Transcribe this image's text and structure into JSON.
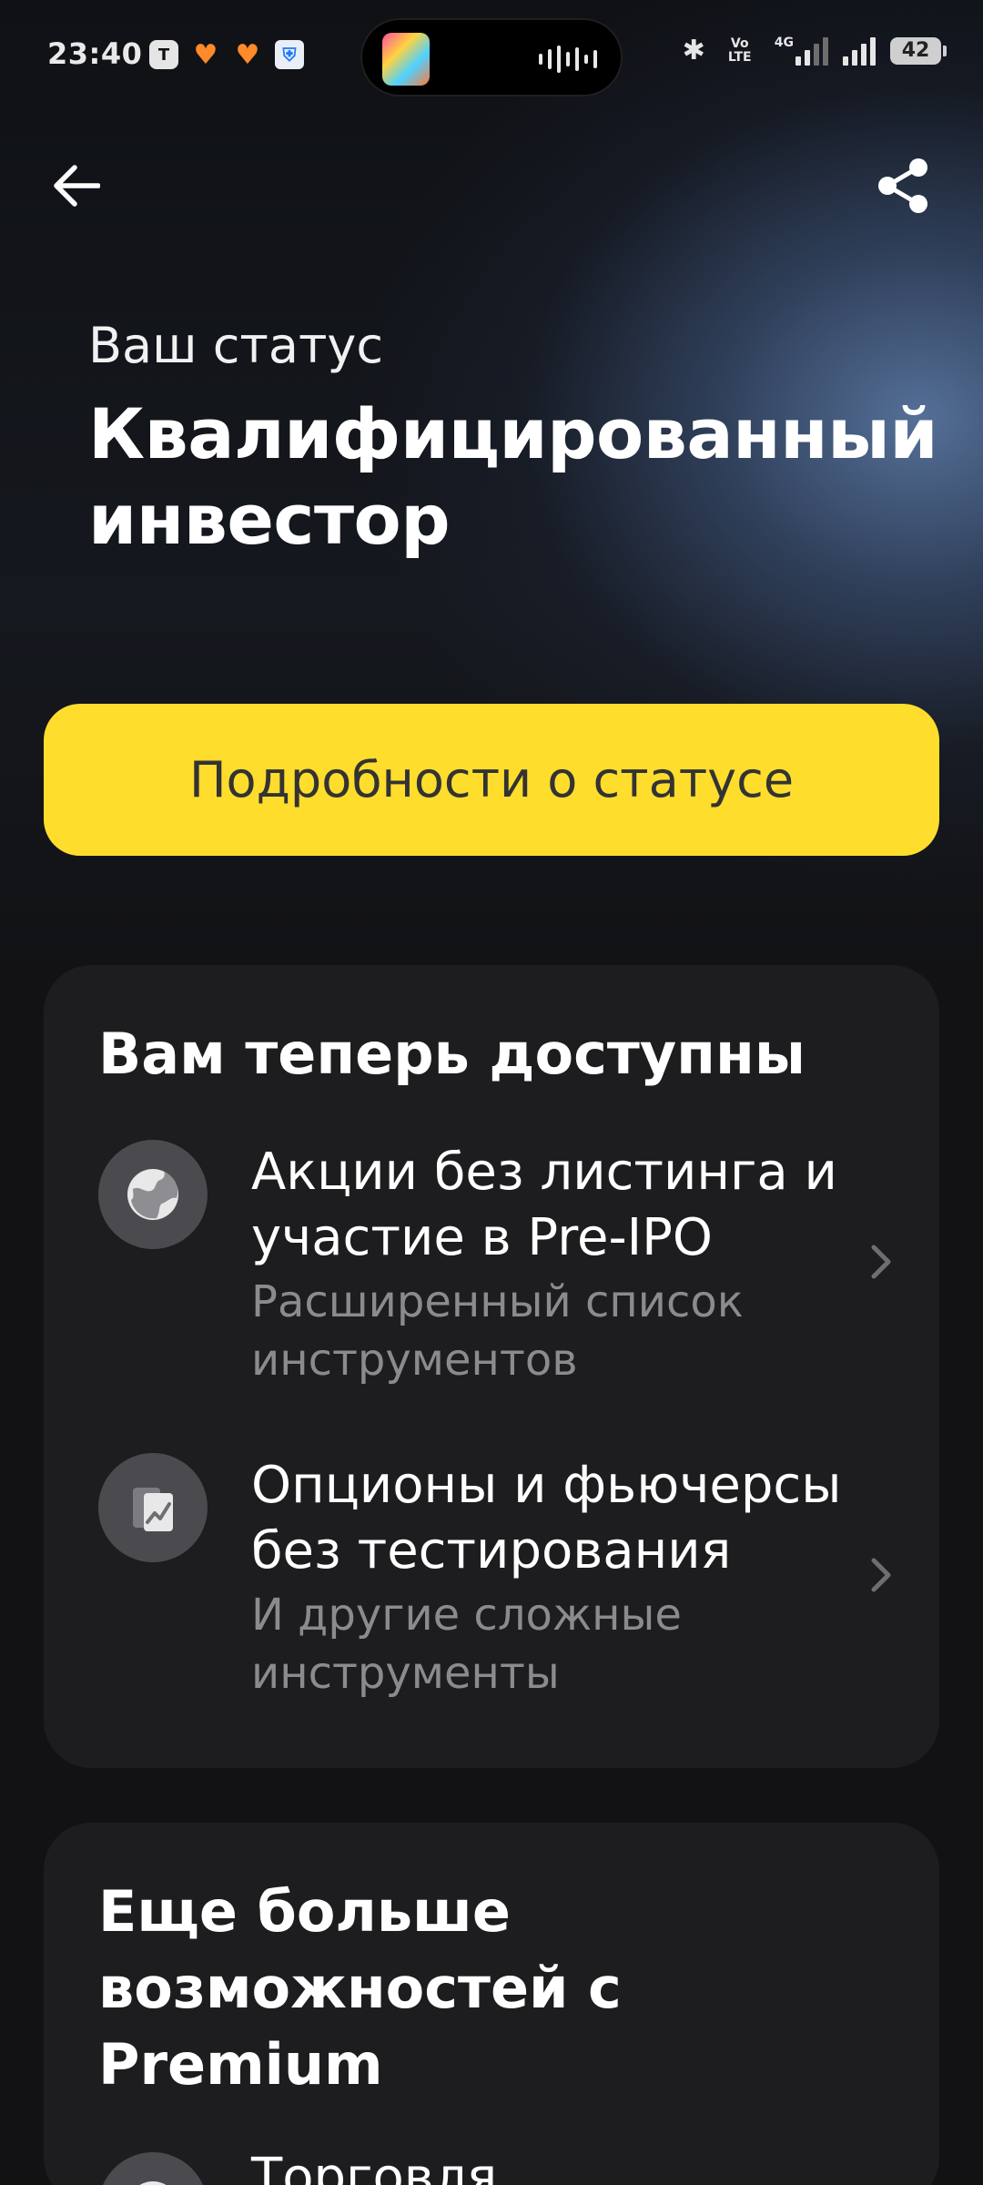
{
  "status_bar": {
    "time": "23:40",
    "notification_icons": [
      "tinkoff-icon",
      "heart-icon",
      "heart-icon",
      "shield-icon"
    ],
    "network_text": "Vo LTE",
    "network_type": "4G",
    "battery": "42"
  },
  "header": {
    "status_label": "Ваш статус",
    "status_title": "Квалифицированный инвестор"
  },
  "cta": {
    "label": "Подробности о статусе"
  },
  "card_available": {
    "title": "Вам теперь доступны",
    "items": [
      {
        "icon": "globe-icon",
        "title": "Акции без листинга и участие в Pre-IPO",
        "subtitle": "Расширенный список инструментов"
      },
      {
        "icon": "chart-icon",
        "title": "Опционы и фьючерсы без тестирования",
        "subtitle": "И другие сложные инструменты"
      }
    ]
  },
  "card_premium": {
    "title": "Еще больше возможностей с Premium",
    "items": [
      {
        "icon": "globe-icon",
        "title": "Торговля"
      }
    ]
  },
  "colors": {
    "accent_yellow": "#ffdd2d",
    "card_bg": "#1d1d1f",
    "page_bg": "#121214",
    "muted_text": "#8b8b8f"
  }
}
